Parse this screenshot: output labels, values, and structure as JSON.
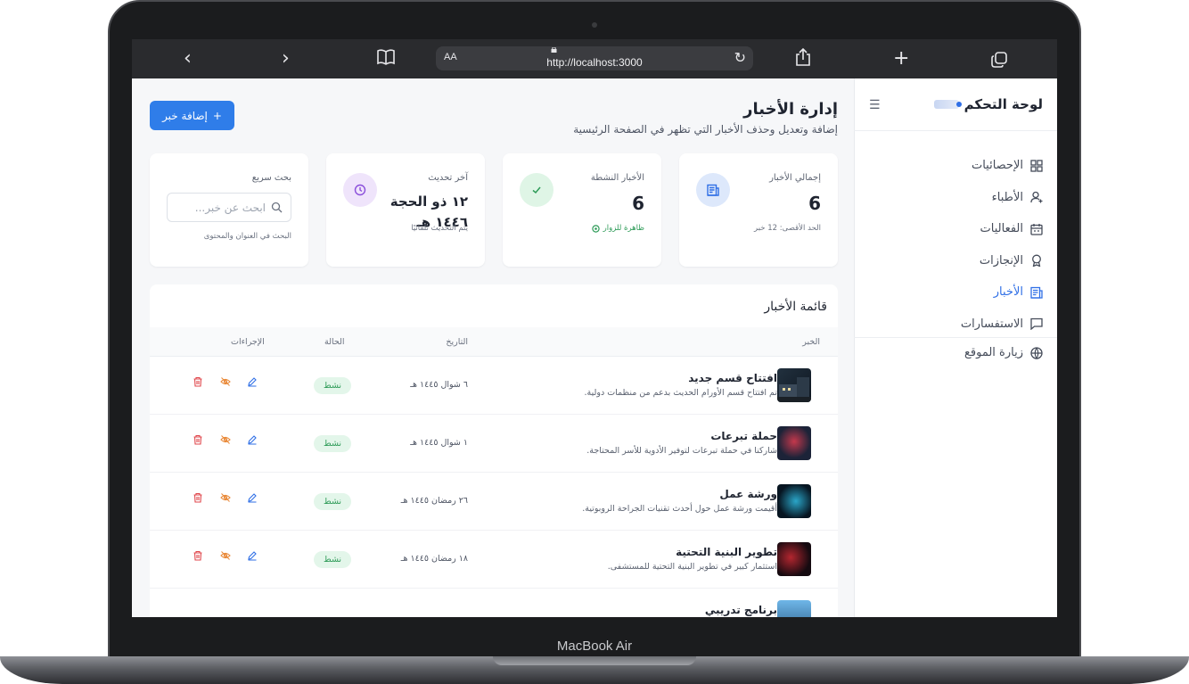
{
  "device": {
    "model_label": "MacBook Air"
  },
  "browser": {
    "url": "http://localhost:3000",
    "aa_label": "AA"
  },
  "sidebar": {
    "brand_title": "لوحة التحكم",
    "items": [
      {
        "label": "الإحصائيات",
        "icon": "grid-icon",
        "active": false
      },
      {
        "label": "الأطباء",
        "icon": "user-plus-icon",
        "active": false
      },
      {
        "label": "الفعاليات",
        "icon": "calendar-icon",
        "active": false
      },
      {
        "label": "الإنجازات",
        "icon": "award-icon",
        "active": false
      },
      {
        "label": "الأخبار",
        "icon": "newspaper-icon",
        "active": true
      },
      {
        "label": "الاستفسارات",
        "icon": "message-icon",
        "active": false
      }
    ],
    "visit_label": "زيارة الموقع"
  },
  "header": {
    "title": "إدارة الأخبار",
    "subtitle": "إضافة وتعديل وحذف الأخبار التي تظهر في الصفحة الرئيسية",
    "add_button": "إضافة خبر",
    "add_button_plus": "+"
  },
  "cards": {
    "total": {
      "label": "إجمالي الأخبار",
      "value": "6",
      "note": "الحد الأقصى: 12 خبر"
    },
    "active": {
      "label": "الأخبار النشطة",
      "value": "6",
      "note": "ظاهرة للزوار"
    },
    "updated": {
      "label": "آخر تحديث",
      "value": "١٢ ذو الحجة ١٤٤٦ هـ",
      "note": "يتم التحديث تلقائيًا"
    },
    "search": {
      "label": "بحث سريع",
      "placeholder": "ابحث عن خبر...",
      "note": "البحث في العنوان والمحتوى"
    }
  },
  "table": {
    "title": "قائمة الأخبار",
    "headers": {
      "news": "الخبر",
      "date": "التاريخ",
      "status": "الحالة",
      "actions": "الإجراءات"
    },
    "rows": [
      {
        "title": "افتتاح قسم جديد",
        "desc": "تم افتتاح قسم الأورام الحديث بدعم من منظمات دولية.",
        "date": "٦ شوال ١٤٤٥ هـ",
        "status": "نشط"
      },
      {
        "title": "حملة تبرعات",
        "desc": "شاركنا في حملة تبرعات لتوفير الأدوية للأسر المحتاجة.",
        "date": "١ شوال ١٤٤٥ هـ",
        "status": "نشط"
      },
      {
        "title": "ورشة عمل",
        "desc": "أقيمت ورشة عمل حول أحدث تقنيات الجراحة الروبوتية.",
        "date": "٢٦ رمضان ١٤٤٥ هـ",
        "status": "نشط"
      },
      {
        "title": "تطوير البنية التحتية",
        "desc": "استثمار كبير في تطوير البنية التحتية للمستشفى.",
        "date": "١٨ رمضان ١٤٤٥ هـ",
        "status": "نشط"
      },
      {
        "title": "برنامج تدريبي",
        "desc": "",
        "date": "",
        "status": ""
      }
    ]
  },
  "colors": {
    "accent": "#2f7de9",
    "status_green": "#2e9b58",
    "delete_red": "#e0474c",
    "hide_orange": "#e98a3a"
  }
}
